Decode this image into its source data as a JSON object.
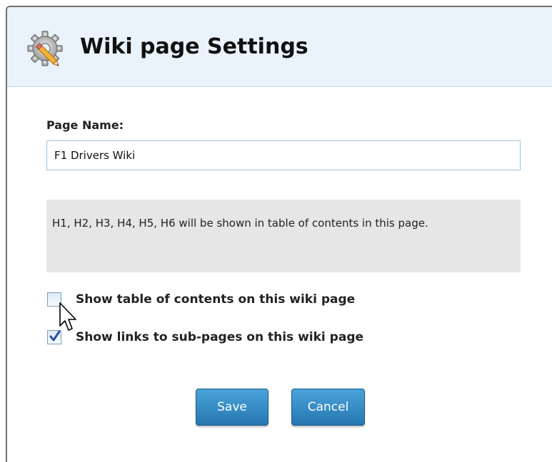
{
  "dialog": {
    "title": "Wiki page Settings",
    "title_icon": "gear-pencil-icon"
  },
  "form": {
    "page_name_label": "Page Name:",
    "page_name_value": "F1 Drivers Wiki",
    "info_text": "H1, H2, H3, H4, H5, H6 will be shown in table of contents in this page."
  },
  "options": [
    {
      "label": "Show table of contents on this wiki page",
      "checked": false
    },
    {
      "label": "Show links to sub-pages on this wiki page",
      "checked": true
    }
  ],
  "buttons": {
    "save_label": "Save",
    "cancel_label": "Cancel"
  },
  "colors": {
    "header_bg": "#eaf3fb",
    "button_top": "#4aa3d9",
    "button_bottom": "#2677b0",
    "info_bg": "#e6e6e6"
  }
}
